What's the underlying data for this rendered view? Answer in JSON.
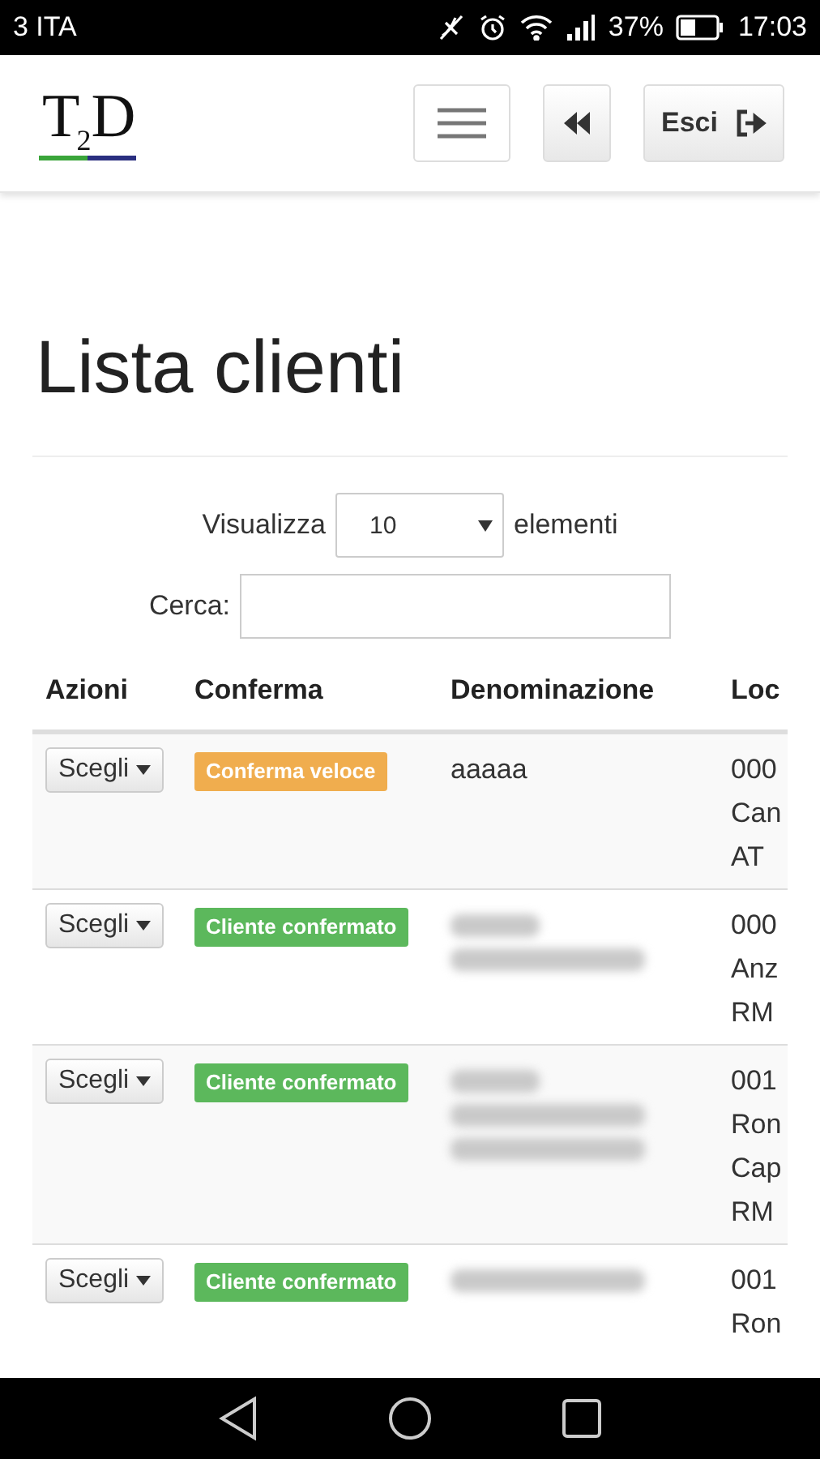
{
  "status_bar": {
    "carrier": "3 ITA",
    "battery": "37%",
    "time": "17:03"
  },
  "header": {
    "logo": "T$_{2}$D",
    "exit_button": "Esci"
  },
  "page_title": "Lista clienti",
  "length_control": {
    "label": "Visualizza",
    "value": "10",
    "suffix": "elementi"
  },
  "search": {
    "label": "Cerca:"
  },
  "table": {
    "columns": [
      "Azioni",
      "Conferma",
      "Denominazione",
      "Loc"
    ],
    "rows": [
      {
        "action": "Scegli",
        "status": {
          "kind": "quick",
          "label": "Conferma veloce"
        },
        "name": {
          "kind": "text",
          "text": "aaaaa"
        },
        "location": [
          "000",
          "Can",
          "AT"
        ]
      },
      {
        "action": "Scegli",
        "status": {
          "kind": "confirmed",
          "label": "Cliente confermato"
        },
        "name": {
          "kind": "blurred",
          "lines": [
            {
              "wide": false
            },
            {
              "wide": true
            }
          ]
        },
        "location": [
          "000",
          "Anz",
          "RM"
        ]
      },
      {
        "action": "Scegli",
        "status": {
          "kind": "confirmed",
          "label": "Cliente confermato"
        },
        "name": {
          "kind": "blurred",
          "lines": [
            {
              "wide": false
            },
            {
              "wide": true
            },
            {
              "wide": true
            }
          ]
        },
        "location": [
          "001",
          "Ron",
          "Cap",
          "RM"
        ]
      },
      {
        "action": "Scegli",
        "status": {
          "kind": "confirmed",
          "label": "Cliente confermato"
        },
        "name": {
          "kind": "blurred",
          "lines": [
            {
              "wide": true
            }
          ]
        },
        "location": [
          "001",
          "Ron"
        ]
      }
    ]
  }
}
